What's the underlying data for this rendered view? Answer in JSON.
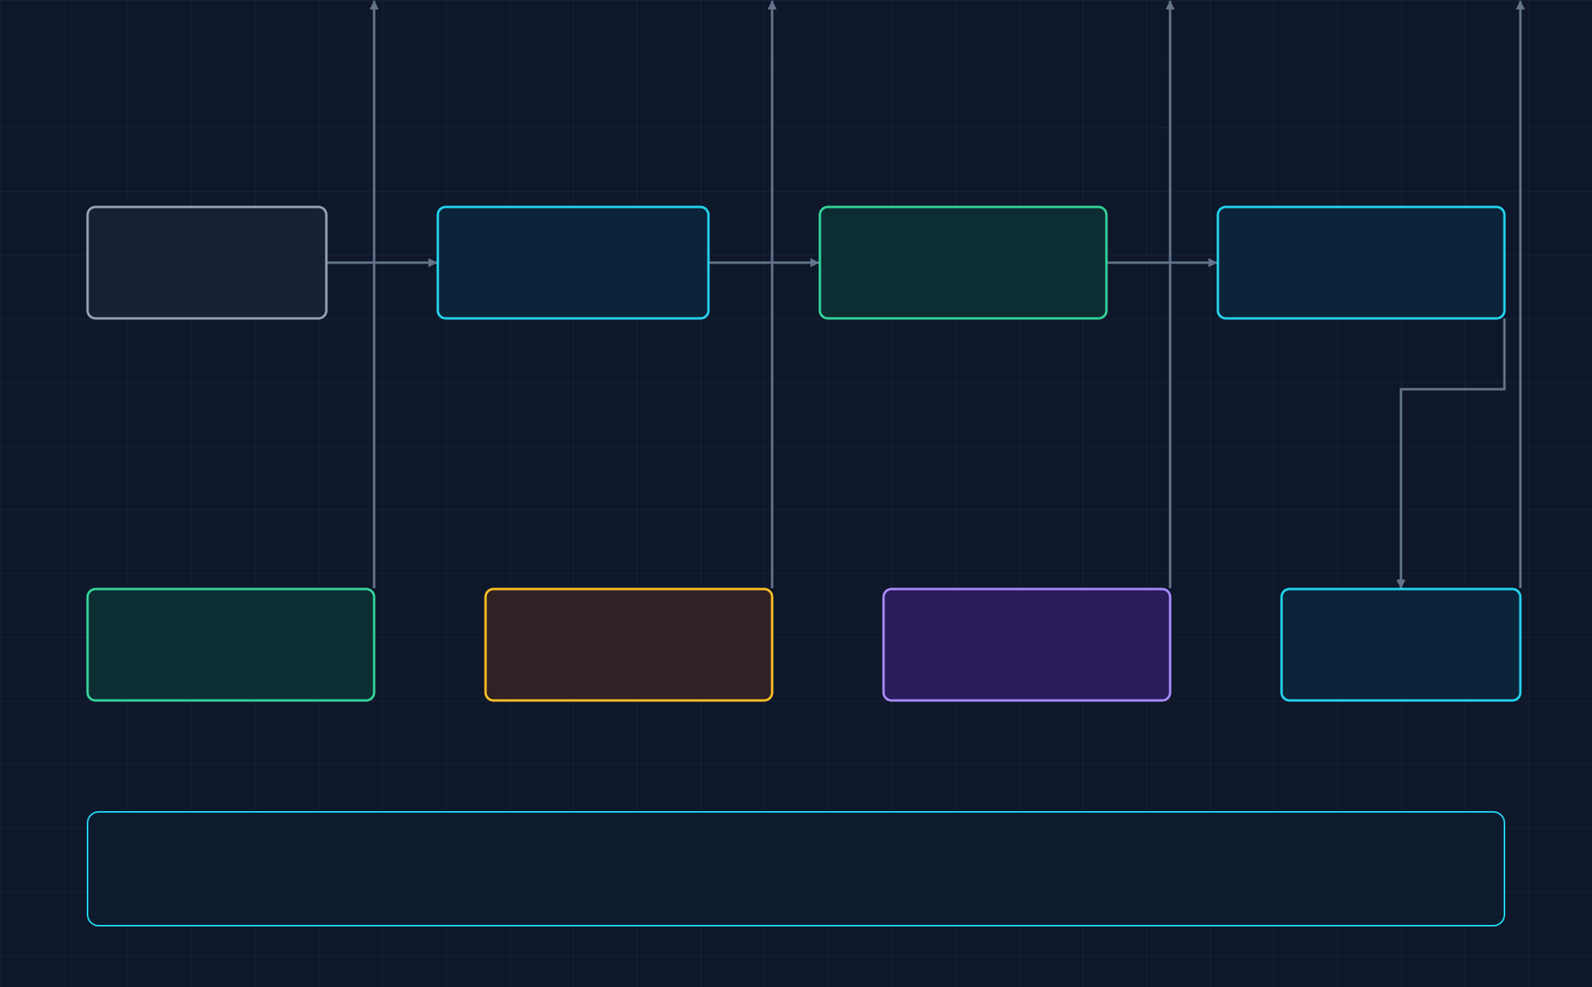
{
  "diagram": {
    "nodes": [
      {
        "id": "node-1",
        "label": "",
        "stroke": "#94a3b8",
        "fill": "#182033"
      },
      {
        "id": "node-2",
        "label": "",
        "stroke": "#22d3ee",
        "fill": "#0c2439"
      },
      {
        "id": "node-3",
        "label": "",
        "stroke": "#34d399",
        "fill": "#0c2e33"
      },
      {
        "id": "node-4",
        "label": "",
        "stroke": "#22d3ee",
        "fill": "#0c2439"
      },
      {
        "id": "node-5",
        "label": "",
        "stroke": "#34d399",
        "fill": "#0c2e33"
      },
      {
        "id": "node-6",
        "label": "",
        "stroke": "#fbbf24",
        "fill": "#2f2124"
      },
      {
        "id": "node-7",
        "label": "",
        "stroke": "#a78bfa",
        "fill": "#2a1b5c"
      },
      {
        "id": "node-8",
        "label": "",
        "stroke": "#22d3ee",
        "fill": "#0c2439"
      },
      {
        "id": "node-9",
        "label": "",
        "stroke": "#22d3ee",
        "fill": "#0d1b2e"
      }
    ],
    "edges": [
      {
        "from": "node-1",
        "to": "node-2"
      },
      {
        "from": "node-2",
        "to": "node-3"
      },
      {
        "from": "node-3",
        "to": "node-4"
      },
      {
        "from": "node-4",
        "to": "node-8"
      },
      {
        "from": "node-5",
        "to": "top-edge"
      },
      {
        "from": "node-6",
        "to": "top-edge"
      },
      {
        "from": "node-7",
        "to": "top-edge"
      },
      {
        "from": "node-8",
        "to": "top-edge"
      }
    ],
    "colors": {
      "background": "#0f172a",
      "connector": "#64748b"
    }
  }
}
